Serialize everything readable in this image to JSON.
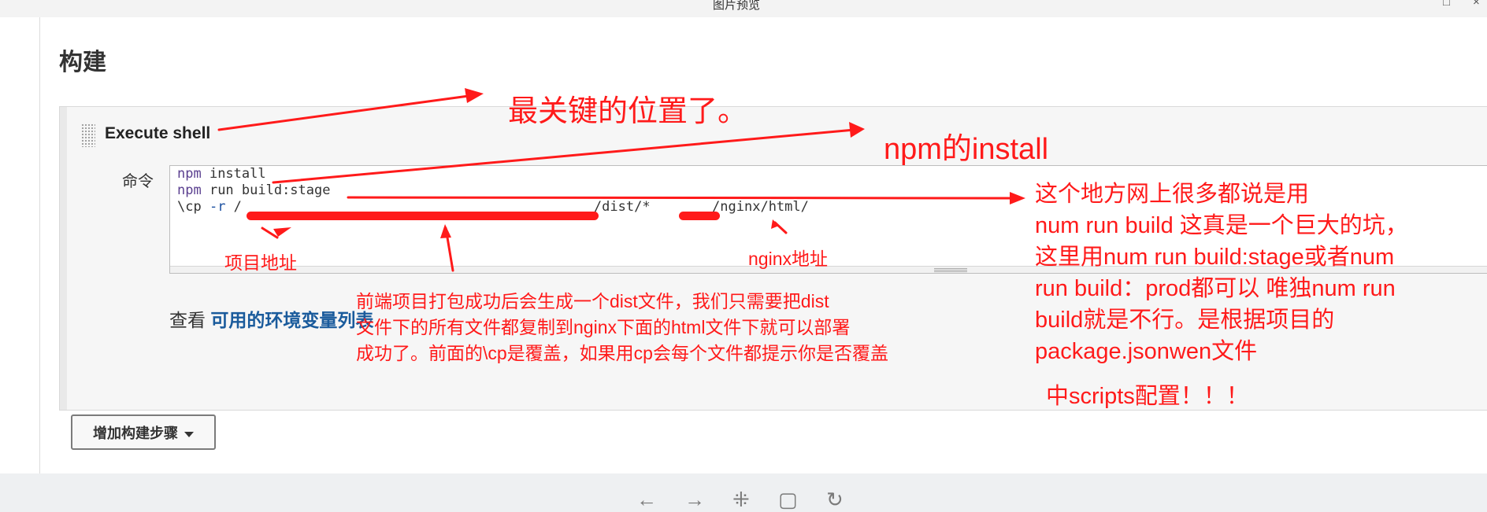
{
  "window": {
    "title": "图片预览",
    "minimize_label": "□",
    "close_label": "×"
  },
  "page": {
    "title": "构建"
  },
  "build_step": {
    "title": "Execute shell",
    "command_label": "命令",
    "command_lines": [
      {
        "kw": "npm",
        "rest": " install"
      },
      {
        "kw": "npm",
        "rest": " run build:stage"
      },
      {
        "pre": "\\cp ",
        "flag": "-r",
        "mid": " /",
        "after": "/dist/*  ",
        "tail": "/nginx/html/"
      }
    ]
  },
  "env_hint": {
    "prefix": "查看",
    "link": "可用的环境变量列表"
  },
  "add_step_button": {
    "label": "增加构建步骤"
  },
  "viewer_toolbar": {
    "icons": [
      "back-icon",
      "forward-icon",
      "fit-icon",
      "fullscreen-icon",
      "rotate-icon"
    ],
    "glyphs": [
      "←",
      "→",
      "⁜",
      "▢",
      "↻"
    ]
  },
  "annotations": {
    "key_position": "最关键的位置了。",
    "npm_install": "npm的install",
    "project_address": "项目地址",
    "nginx_address": "nginx地址",
    "build_note": [
      "这个地方网上很多都说是用",
      "num run build 这真是一个巨大的坑，",
      "这里用num run build:stage或者num",
      "run build：prod都可以 唯独num run",
      "build就是不行。是根据项目的",
      "package.jsonwen文件"
    ],
    "scripts_note": "中scripts配置！！！",
    "dist_note": [
      "前端项目打包成功后会生成一个dist文件，我们只需要把dist",
      "文件下的所有文件都复制到nginx下面的html文件下就可以部署",
      "成功了。前面的\\cp是覆盖，如果用cp会每个文件都提示你是否覆盖"
    ]
  },
  "colors": {
    "annotation_red": "#ff1a1a",
    "link_blue": "#1a5b9c",
    "keyword_purple": "#5a3f8f"
  }
}
